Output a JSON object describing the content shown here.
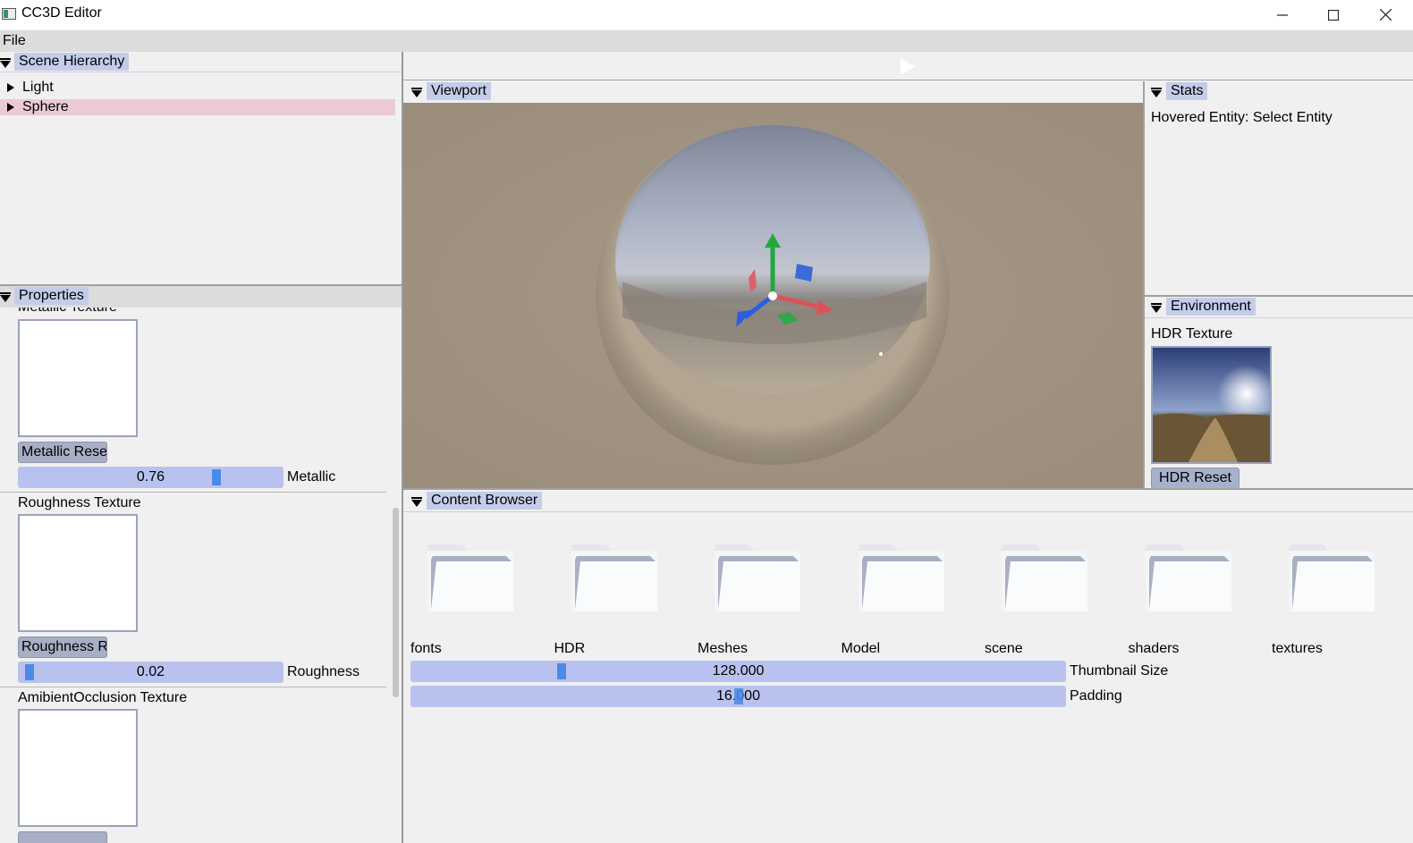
{
  "window": {
    "title": "CC3D Editor",
    "minimize_icon": "minimize-icon",
    "maximize_icon": "maximize-icon",
    "close_icon": "close-icon"
  },
  "menubar": {
    "file": "File"
  },
  "scene_hierarchy": {
    "title": "Scene Hierarchy",
    "items": [
      {
        "label": "Light",
        "selected": false
      },
      {
        "label": "Sphere",
        "selected": true
      }
    ]
  },
  "properties": {
    "title": "Properties",
    "metallic": {
      "texture_label": "Metallic Texture",
      "reset_label": "Metallic Rese",
      "value_text": "0.76",
      "value": 0.76,
      "label": "Metallic"
    },
    "roughness": {
      "texture_label": "Roughness Texture",
      "reset_label": "Roughness R",
      "value_text": "0.02",
      "value": 0.02,
      "label": "Roughness"
    },
    "ao": {
      "texture_label": "AmibientOcclusion Texture"
    }
  },
  "toolbar": {
    "play_icon": "play-icon"
  },
  "viewport": {
    "title": "Viewport"
  },
  "stats": {
    "title": "Stats",
    "hovered_entity": "Hovered Entity: Select Entity"
  },
  "environment": {
    "title": "Environment",
    "hdr_label": "HDR Texture",
    "reset_label": "HDR Reset"
  },
  "content_browser": {
    "title": "Content Browser",
    "folders": [
      "fonts",
      "HDR",
      "Meshes",
      "Model",
      "scene",
      "shaders",
      "textures"
    ],
    "thumbnail_size": {
      "value_text": "128.000",
      "label": "Thumbnail Size"
    },
    "padding": {
      "value_text": "16.000",
      "label": "Padding"
    }
  },
  "colors": {
    "accent": "#c3cdea",
    "selected_row": "#ebcad6",
    "slider": "#b9c2ee",
    "slider_grab": "#4a8ae8"
  }
}
